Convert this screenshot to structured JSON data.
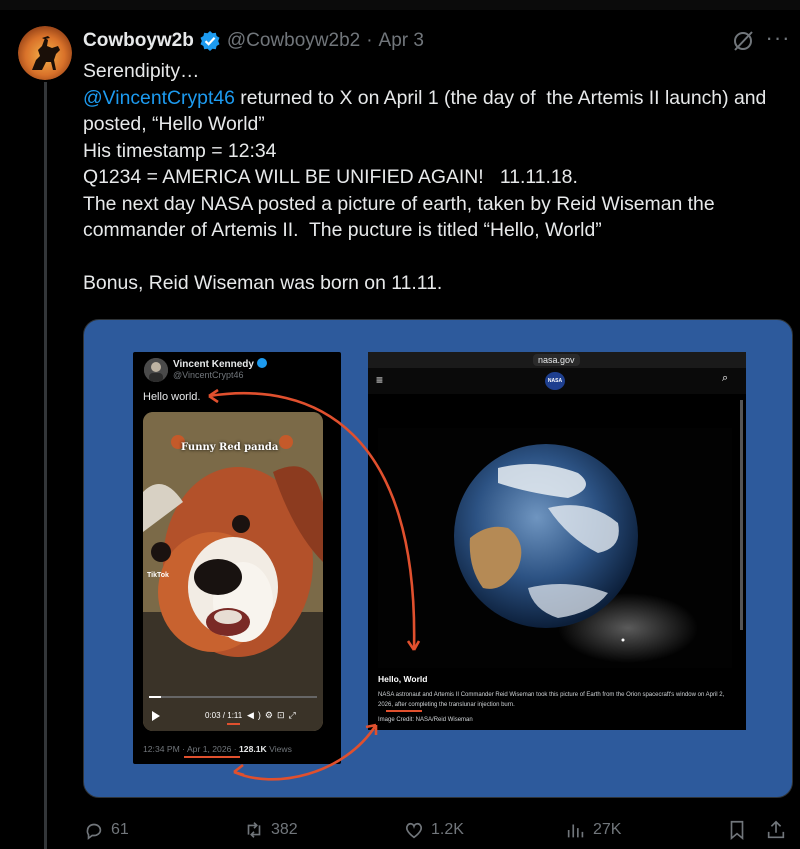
{
  "tweet": {
    "author_name": "Cowboyw2b",
    "handle": "@Cowboyw2b2",
    "separator": "·",
    "date": "Apr 3",
    "line1": "Serendipity…",
    "mention": "@VincentCrypt46",
    "line2_rest": " returned to X on April 1 (the day of  the Artemis II launch) and posted, “Hello World”",
    "line3": "His timestamp = 12:34",
    "line4": "Q1234 = AMERICA WILL BE UNIFIED AGAIN!   11.11.18.",
    "line5": "The next day NASA posted a picture of earth, taken by Reid Wiseman the commander of Artemis II.  The pucture is titled “Hello, World”",
    "line6": "Bonus, Reid Wiseman was born on 11.11.",
    "more": "···"
  },
  "embedded_left": {
    "name": "Vincent Kennedy",
    "handle": "@VincentCrypt46",
    "text": "Hello world.",
    "video_caption": "Funny Red panda",
    "tiktok_label": "TikTok",
    "video_time": "0:03 / 1:11",
    "meta_time": "12:34 PM · Apr 1, 2026 · ",
    "meta_views_count": "128.1K",
    "meta_views_label": " Views"
  },
  "embedded_right": {
    "url": "nasa.gov",
    "logo": "NASA",
    "heading": "Hello, World",
    "description": "NASA astronaut and Artemis II Commander Reid Wiseman took this picture of Earth from the Orion spacecraft's window on April 2, 2026, after completing the translunar injection burn.",
    "credit": "Image Credit: NASA/Reid Wiseman"
  },
  "actions": {
    "replies": "61",
    "reposts": "382",
    "likes": "1.2K",
    "views": "27K"
  },
  "colors": {
    "background": "#000000",
    "link": "#1d9bf0",
    "verified": "#1d9bf0",
    "muted": "#71767b",
    "media_bg": "#2d5a9c",
    "annotation": "#e0502e"
  },
  "icons": [
    "verified-badge-icon",
    "grok-icon",
    "more-icon",
    "reply-icon",
    "repost-icon",
    "like-icon",
    "views-icon",
    "bookmark-icon",
    "share-icon",
    "play-icon",
    "search-icon",
    "menu-icon"
  ]
}
